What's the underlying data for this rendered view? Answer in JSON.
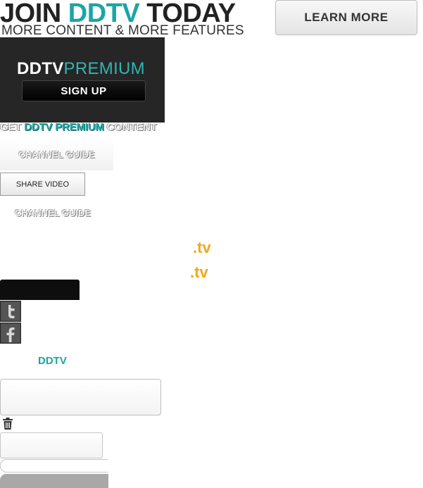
{
  "banner": {
    "title_prefix": "JOIN ",
    "title_accent": "DDTV",
    "title_suffix": " TODAY",
    "subtitle": "MORE CONTENT & MORE FEATURES",
    "learn_more_label": "LEARN MORE"
  },
  "premium": {
    "logo_main": "DDTV",
    "logo_sub": "PREMIUM",
    "signup_label": "SIGN UP",
    "get_prefix": "GET ",
    "get_accent": "DDTV PREMIUM",
    "get_suffix": " CONTENT"
  },
  "nav": {
    "channel_guide_label": "CHANNEL GUIDE",
    "share_video_label": "SHARE VIDEO",
    "channel_guide_label_2": "CHANNEL GUIDE"
  },
  "domains": {
    "tv_1": ".tv",
    "tv_2": ".tv"
  },
  "social": {
    "twitter_icon": "twitter-icon",
    "facebook_icon": "facebook-icon"
  },
  "brand": {
    "ddtv_label": "DDTV"
  },
  "colors": {
    "accent_teal": "#1ba5a5",
    "accent_orange": "#f2a818",
    "dark_panel": "#262626"
  }
}
